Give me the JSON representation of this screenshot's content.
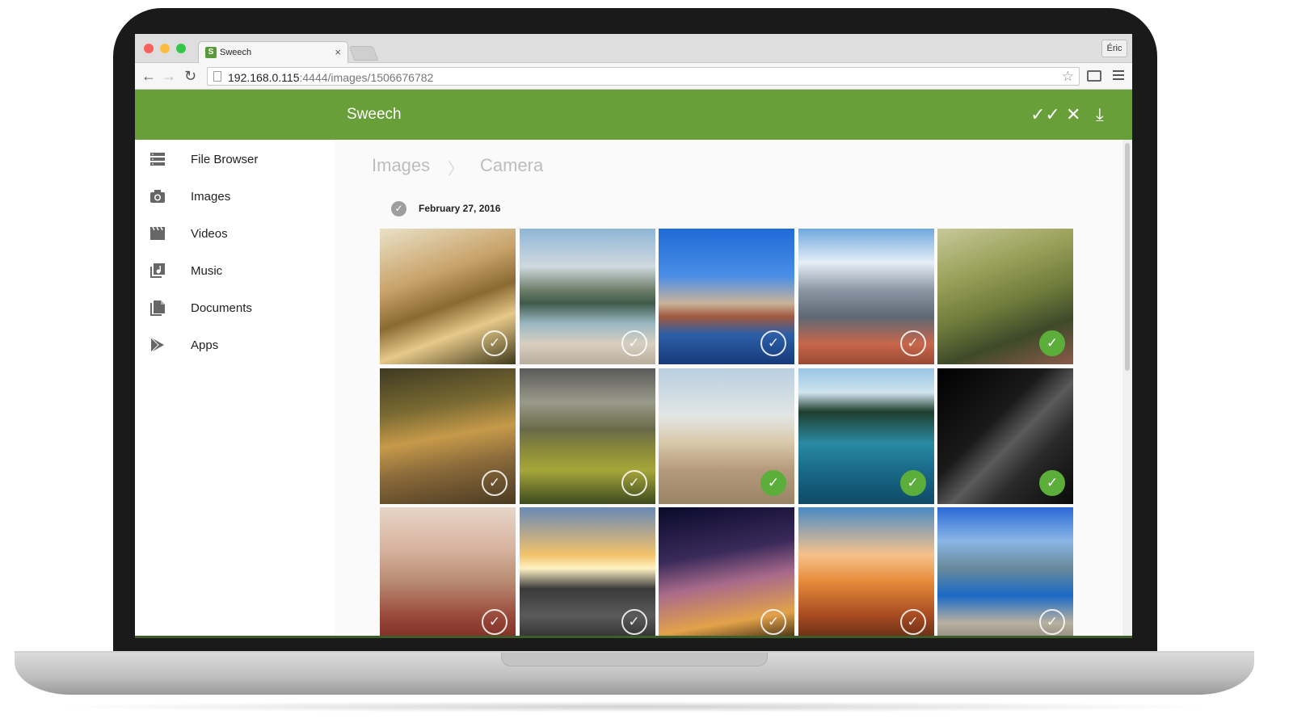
{
  "browser": {
    "tab_title": "Sweech",
    "tab_close": "×",
    "user": "Éric",
    "url_host": "192.168.0.115",
    "url_path": ":4444/images/1506676782"
  },
  "app": {
    "title": "Sweech",
    "accent": "#689f38",
    "check_accent": "#5cae3b"
  },
  "sidebar": {
    "items": [
      {
        "label": "File Browser",
        "icon": "list-icon"
      },
      {
        "label": "Images",
        "icon": "camera-icon"
      },
      {
        "label": "Videos",
        "icon": "clapper-icon"
      },
      {
        "label": "Music",
        "icon": "music-library-icon"
      },
      {
        "label": "Documents",
        "icon": "document-icon"
      },
      {
        "label": "Apps",
        "icon": "play-store-icon"
      }
    ]
  },
  "breadcrumb": [
    "Images",
    "Camera"
  ],
  "gallery": {
    "date": "February 27, 2016",
    "photos": [
      {
        "selected": false,
        "bg": "linear-gradient(160deg,#e9e2c8 0%,#c9a36a 35%,#8a6a32 55%,#e7c98a 72%,#3e3a1a 100%)"
      },
      {
        "selected": false,
        "bg": "linear-gradient(180deg,#8fb6d6 0%,#cfd9df 28%,#6f7f6a 45%,#3f5a4a 55%,#9bb8c2 70%,#d8cfc0 85%,#b8ae9e 100%)"
      },
      {
        "selected": false,
        "bg": "linear-gradient(180deg,#1e6ad8 0%,#4a8ee6 35%,#c9b39a 55%,#a0583e 65%,#2c5fa8 78%,#163a78 100%)"
      },
      {
        "selected": false,
        "bg": "linear-gradient(180deg,#6fa8de 0%,#e6eef6 25%,#8d98a6 45%,#5c6874 65%,#c8664a 85%,#9a4a36 100%)"
      },
      {
        "selected": true,
        "bg": "linear-gradient(160deg,#c7c99a 0%,#9aa15a 30%,#6e7a3a 55%,#3e4a2a 75%,#8a5a4a 100%)"
      },
      {
        "selected": false,
        "bg": "linear-gradient(170deg,#3e3a22 0%,#7a6a32 30%,#c69a4a 50%,#8a6a3a 70%,#4a3a22 100%)"
      },
      {
        "selected": false,
        "bg": "linear-gradient(180deg,#5a5a5a 0%,#9a9a8a 25%,#6a6a4a 45%,#8a8a3a 60%,#a6a63a 75%,#3e4a1e 100%)"
      },
      {
        "selected": true,
        "bg": "linear-gradient(180deg,#b9cfe0 0%,#e2e6e4 35%,#d8c8aa 55%,#b49a7a 75%,#9a8466 100%)"
      },
      {
        "selected": true,
        "bg": "linear-gradient(180deg,#9ac6e4 0%,#cfe3ef 18%,#1f3e2e 32%,#2a8aa2 55%,#1a6a8a 75%,#0e4a66 100%)"
      },
      {
        "selected": true,
        "bg": "linear-gradient(135deg,#000000 0%,#1a1a1a 40%,#5a5a5a 55%,#2a2a2a 70%,#0a0a0a 100%)"
      },
      {
        "selected": false,
        "bg": "linear-gradient(180deg,#e6d6c8 0%,#d8b4a0 30%,#b88a72 55%,#9a4a3a 80%,#7a2a22 100%)"
      },
      {
        "selected": false,
        "bg": "linear-gradient(180deg,#6a8ab6 0%,#f2c26a 35%,#fff2c2 45%,#3a3a3a 60%,#5a5a5a 80%,#2a2a2a 100%)"
      },
      {
        "selected": false,
        "bg": "linear-gradient(170deg,#0a0a2a 0%,#3a2a5a 35%,#a86a8a 55%,#e2a24a 80%,#2a1a0a 100%)"
      },
      {
        "selected": false,
        "bg": "linear-gradient(180deg,#4a8ac6 0%,#f6c28a 35%,#e68a3a 55%,#a64a22 80%,#5a2a12 100%)"
      },
      {
        "selected": false,
        "bg": "linear-gradient(180deg,#2a6ad6 0%,#8ab6e6 25%,#6a8a9a 45%,#1a6ac6 65%,#b8b0a0 85%,#8a847a 100%)"
      }
    ]
  }
}
